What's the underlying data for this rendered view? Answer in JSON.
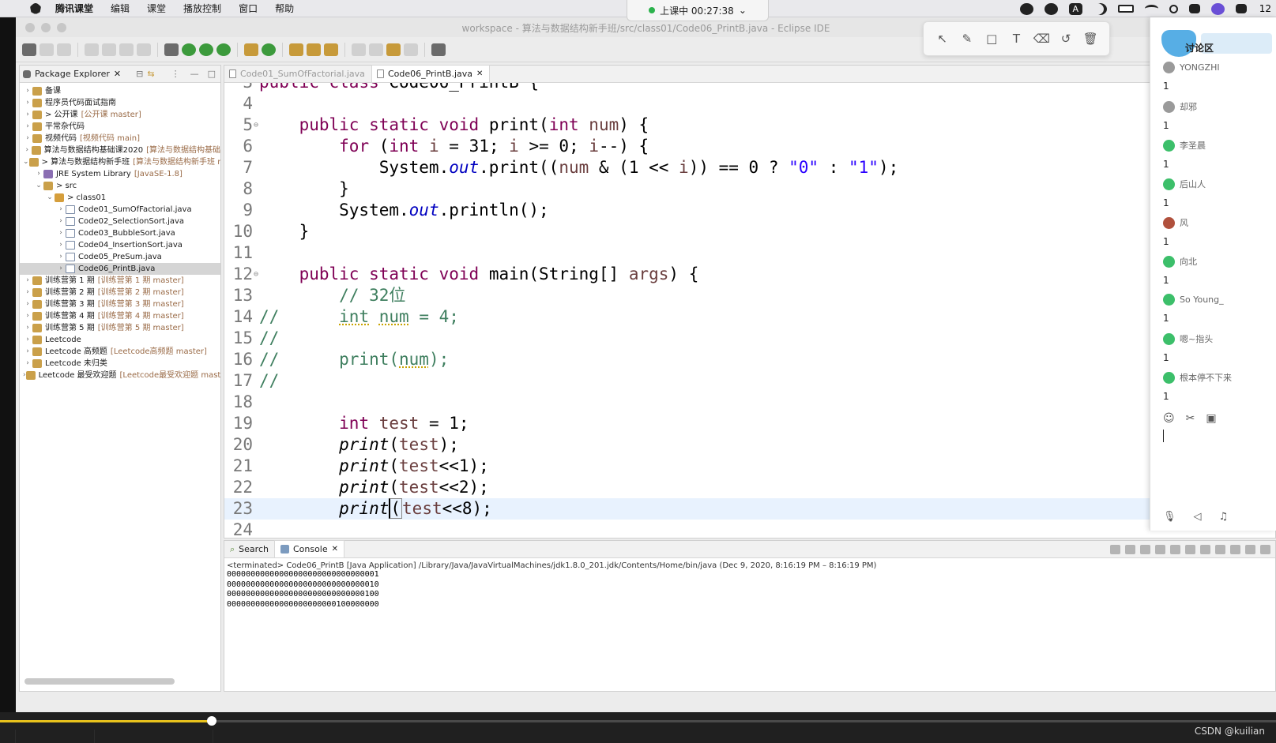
{
  "menubar": {
    "app": "腾讯课堂",
    "items": [
      "编辑",
      "课堂",
      "播放控制",
      "窗口",
      "帮助"
    ],
    "time": "12"
  },
  "recording": {
    "label": "上课中 00:27:38",
    "chevron": "⌄"
  },
  "window": {
    "title": "workspace - 算法与数据结构新手班/src/class01/Code06_PrintB.java - Eclipse IDE"
  },
  "palette": {
    "tools": [
      "↖",
      "✎",
      "□",
      "T",
      "⌫",
      "↺",
      "🗑"
    ]
  },
  "package_explorer": {
    "tab_label": "Package Explorer",
    "items": [
      {
        "arrow": "›",
        "label": "备课",
        "deco": ""
      },
      {
        "arrow": "›",
        "label": "程序员代码面试指南",
        "deco": ""
      },
      {
        "arrow": "›",
        "label": "> 公开课",
        "deco": "[公开课 master]"
      },
      {
        "arrow": "›",
        "label": "平常杂代码",
        "deco": ""
      },
      {
        "arrow": "›",
        "label": "视频代码",
        "deco": "[视频代码 main]"
      },
      {
        "arrow": "›",
        "label": "算法与数据结构基础课2020",
        "deco": "[算法与数据结构基础"
      },
      {
        "arrow": "⌄",
        "label": "> 算法与数据结构新手班",
        "deco": "[算法与数据结构新手班 r"
      },
      {
        "arrow": "›",
        "label": "JRE System Library",
        "deco": "[JavaSE-1.8]"
      },
      {
        "arrow": "⌄",
        "label": "> src",
        "deco": ""
      },
      {
        "arrow": "⌄",
        "label": "> class01",
        "deco": ""
      },
      {
        "arrow": "›",
        "label": "Code01_SumOfFactorial.java",
        "deco": ""
      },
      {
        "arrow": "›",
        "label": "Code02_SelectionSort.java",
        "deco": ""
      },
      {
        "arrow": "›",
        "label": "Code03_BubbleSort.java",
        "deco": ""
      },
      {
        "arrow": "›",
        "label": "Code04_InsertionSort.java",
        "deco": ""
      },
      {
        "arrow": "›",
        "label": "Code05_PreSum.java",
        "deco": ""
      },
      {
        "arrow": "›",
        "label": "Code06_PrintB.java",
        "deco": ""
      },
      {
        "arrow": "›",
        "label": "训练营第 1 期",
        "deco": "[训练营第 1 期 master]"
      },
      {
        "arrow": "›",
        "label": "训练营第 2 期",
        "deco": "[训练营第 2 期 master]"
      },
      {
        "arrow": "›",
        "label": "训练营第 3 期",
        "deco": "[训练营第 3 期 master]"
      },
      {
        "arrow": "›",
        "label": "训练营第 4 期",
        "deco": "[训练营第 4 期 master]"
      },
      {
        "arrow": "›",
        "label": "训练营第 5 期",
        "deco": "[训练营第 5 期 master]"
      },
      {
        "arrow": "›",
        "label": "Leetcode",
        "deco": ""
      },
      {
        "arrow": "›",
        "label": "Leetcode 高频题",
        "deco": "[Leetcode高频题 master]"
      },
      {
        "arrow": "›",
        "label": "Leetcode 未归类",
        "deco": ""
      },
      {
        "arrow": "›",
        "label": "Leetcode 最受欢迎题",
        "deco": "[Leetcode最受欢迎题 mast"
      }
    ]
  },
  "editor": {
    "tabs": [
      "Code01_SumOfFactorial.java",
      "Code06_PrintB.java"
    ]
  },
  "chat": {
    "title": "讨论区",
    "messages": [
      {
        "user": "YONGZHI",
        "text": "1"
      },
      {
        "user": "却邪",
        "text": "1"
      },
      {
        "user": "李圣晨",
        "text": "1"
      },
      {
        "user": "后山人",
        "text": "1"
      },
      {
        "user": "风",
        "text": "1"
      },
      {
        "user": "向北",
        "text": "1"
      },
      {
        "user": "So Young_",
        "text": "1"
      },
      {
        "user": "嗯~指头",
        "text": "1"
      },
      {
        "user": "根本停不下来",
        "text": "1"
      }
    ],
    "tools": [
      "☺",
      "✂",
      "▣"
    ],
    "bottom_tools": [
      "🎙",
      "◁",
      "♫"
    ]
  },
  "console": {
    "tabs": [
      "Search",
      "Console"
    ],
    "header": "<terminated> Code06_PrintB [Java Application] /Library/Java/JavaVirtualMachines/jdk1.8.0_201.jdk/Contents/Home/bin/java  (Dec 9, 2020, 8:16:19 PM – 8:16:19 PM)",
    "output": [
      "00000000000000000000000000000001",
      "00000000000000000000000000000010",
      "00000000000000000000000000000100",
      "00000000000000000000000100000000"
    ]
  },
  "player": {
    "progress": 0.166,
    "watermark": "CSDN @kuilian"
  }
}
